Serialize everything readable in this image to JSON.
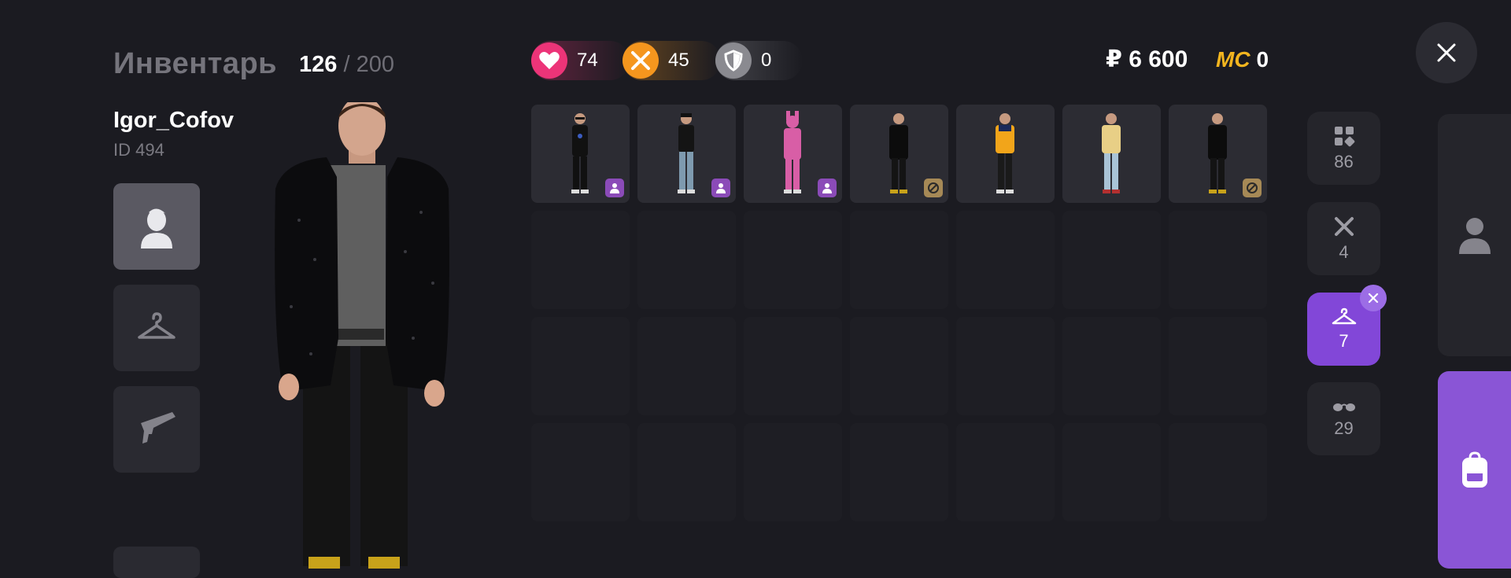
{
  "inventory": {
    "title": "Инвентарь",
    "used": "126",
    "separator": "/",
    "max": "200"
  },
  "player": {
    "name": "Igor_Cofov",
    "id": "ID 494"
  },
  "left_tabs": [
    {
      "name": "appearance",
      "icon": "person-icon",
      "active": true
    },
    {
      "name": "clothes",
      "icon": "hanger-icon",
      "active": false
    },
    {
      "name": "weapons",
      "icon": "pistol-icon",
      "active": false
    }
  ],
  "stats": {
    "health": "74",
    "food": "45",
    "armor": "0"
  },
  "currency": {
    "money": "₽ 6 600",
    "mc_label": "MC",
    "mc_value": "0"
  },
  "colors": {
    "accent": "#8247d8",
    "health": "#ec3478",
    "food": "#f5961e",
    "mc": "#f3b51f",
    "background": "#1b1b21"
  },
  "categories": [
    {
      "icon": "grid-icon",
      "count": "86",
      "active": false
    },
    {
      "icon": "fork-knife-icon",
      "count": "4",
      "active": false
    },
    {
      "icon": "hanger-icon",
      "count": "7",
      "active": true
    },
    {
      "icon": "glasses-icon",
      "count": "29",
      "active": false
    }
  ],
  "items": [
    {
      "outfit": "black-outfit-sunglasses",
      "badge": "person-icon"
    },
    {
      "outfit": "black-tshirt-jeans",
      "badge": "person-icon"
    },
    {
      "outfit": "pink-bunny-costume",
      "badge": "person-icon"
    },
    {
      "outfit": "black-jacket",
      "badge": "blocked-icon"
    },
    {
      "outfit": "yellow-jacket",
      "badge": ""
    },
    {
      "outfit": "gold-shirt-jeans",
      "badge": ""
    },
    {
      "outfit": "black-jacket",
      "badge": "blocked-icon"
    }
  ],
  "right_panels": [
    {
      "icon": "person-icon"
    },
    {
      "icon": "backpack-icon"
    }
  ]
}
